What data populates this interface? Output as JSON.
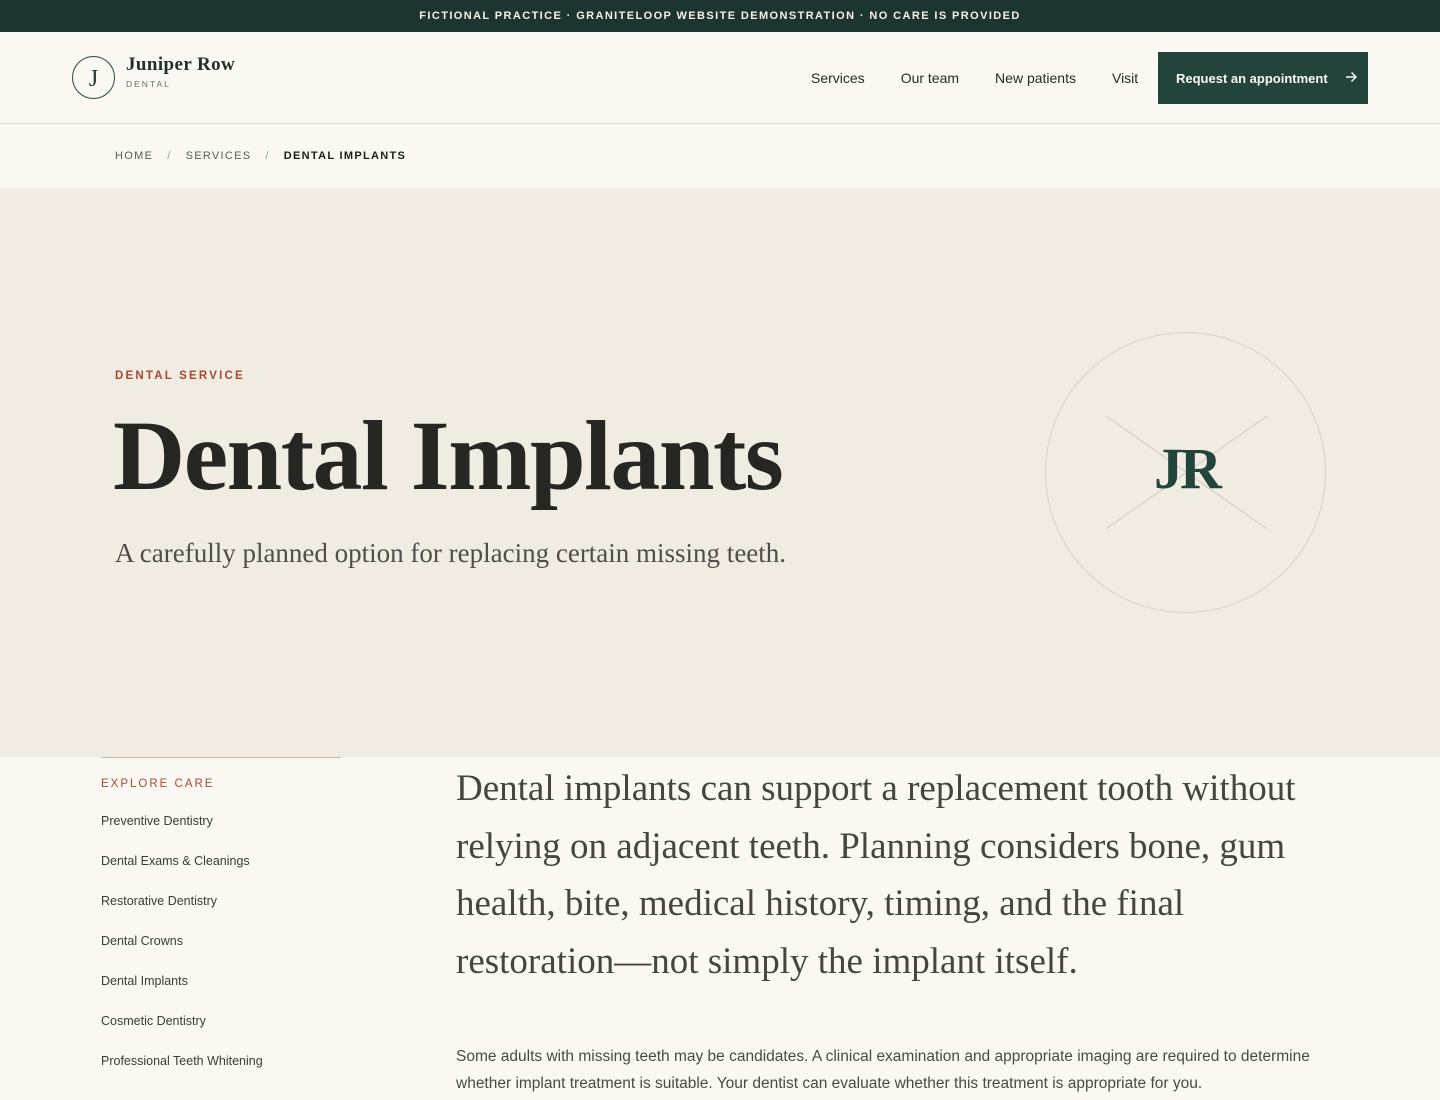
{
  "topbar": {
    "notice": "FICTIONAL PRACTICE · GRANITELOOP WEBSITE DEMONSTRATION · NO CARE IS PROVIDED"
  },
  "header": {
    "logo_initial": "J",
    "logo_name": "Juniper Row",
    "logo_sub": "DENTAL",
    "nav": [
      {
        "label": "Services"
      },
      {
        "label": "Our team"
      },
      {
        "label": "New patients"
      },
      {
        "label": "Visit"
      }
    ],
    "cta_label": "Request an appointment",
    "cta_icon": "arrow-right-icon"
  },
  "breadcrumb": {
    "home": "HOME",
    "services": "SERVICES",
    "current": "DENTAL IMPLANTS",
    "separator": "/"
  },
  "hero": {
    "eyebrow": "DENTAL SERVICE",
    "title": "Dental Implants",
    "subtitle": "A carefully planned option for replacing certain missing teeth.",
    "badge_text": "JR"
  },
  "sidebar": {
    "heading": "EXPLORE CARE",
    "items": [
      {
        "label": "Preventive Dentistry"
      },
      {
        "label": "Dental Exams & Cleanings"
      },
      {
        "label": "Restorative Dentistry"
      },
      {
        "label": "Dental Crowns"
      },
      {
        "label": "Dental Implants"
      },
      {
        "label": "Cosmetic Dentistry"
      },
      {
        "label": "Professional Teeth Whitening"
      }
    ]
  },
  "content": {
    "lead": "Dental implants can support a replacement tooth without relying on adjacent teeth. Planning considers bone, gum health, bite, medical history, timing, and the final restoration—not simply the implant itself.",
    "body": "Some adults with missing teeth may be candidates. A clinical examination and appropriate imaging are required to determine whether implant treatment is suitable. Your dentist can evaluate whether this treatment is appropriate for you."
  },
  "colors": {
    "brand_dark": "#1d3530",
    "accent_green": "#22443a",
    "accent_rust": "#a54a30",
    "hero_bg": "#f1ece2",
    "page_bg": "#f9f8f3"
  }
}
